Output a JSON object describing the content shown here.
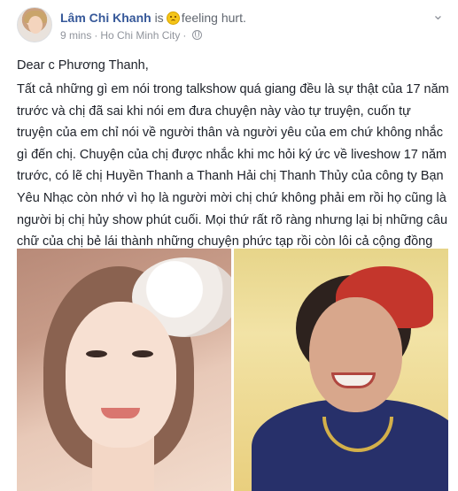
{
  "post": {
    "author": "Lâm Chi Khanh",
    "is_text": "is",
    "feeling": "feeling hurt.",
    "feeling_icon": "sad-emoji-icon",
    "time": "9 mins",
    "separator": "·",
    "location": "Ho Chi Minh City",
    "separator2": "·",
    "privacy_icon": "globe-icon",
    "options_icon": "chevron-down-icon",
    "greeting": "Dear c Phương Thanh,",
    "message": "Tất cả những gì em nói trong talkshow quá giang đều là sự thật của 17 năm trước và chị đã sai khi nói em đưa chuyện này vào tự truyện, cuốn tự truyện của em chỉ nói về người thân và người yêu của em chứ không nhắc gì đến chị. Chuyện của chị được nhắc khi mc hỏi ký ức về liveshow 17 năm trước, có lẽ chị Huyền Thanh a Thanh Hải chị Thanh Thủy của công ty Bạn Yêu Nhạc còn nhớ vì họ là người mời chị chứ không phải em rồi họ cũng là người bị chị hủy show phút cuối. Mọi thứ rất rõ ràng nhưng lại bị những câu chữ của chị bẻ lái thành những chuyện phức tạp rồi còn lôi cả cộng đồng LGBT của chúng em ra sỉ nhục như thế này. Em mong chị dừng lại."
  },
  "colors": {
    "author": "#365899",
    "meta": "#90949c",
    "text": "#1d2129"
  }
}
